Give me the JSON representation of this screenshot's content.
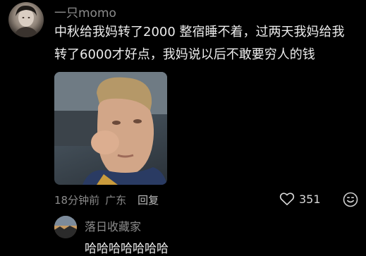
{
  "comment": {
    "username": "一只momo",
    "content_lines": [
      "中秋给我妈转了2000 整宿睡不着，过两天我妈给我",
      "转了6000才好点，我妈说以后不敢要穷人的钱"
    ],
    "time": "18分钟前",
    "location": "广东",
    "reply_label": "回复",
    "like_count": "351",
    "icons": {
      "like": "heart-icon",
      "emoji": "emoji-icon"
    }
  },
  "reply": {
    "username": "落日收藏家",
    "text": "哈哈哈哈哈哈哈"
  }
}
